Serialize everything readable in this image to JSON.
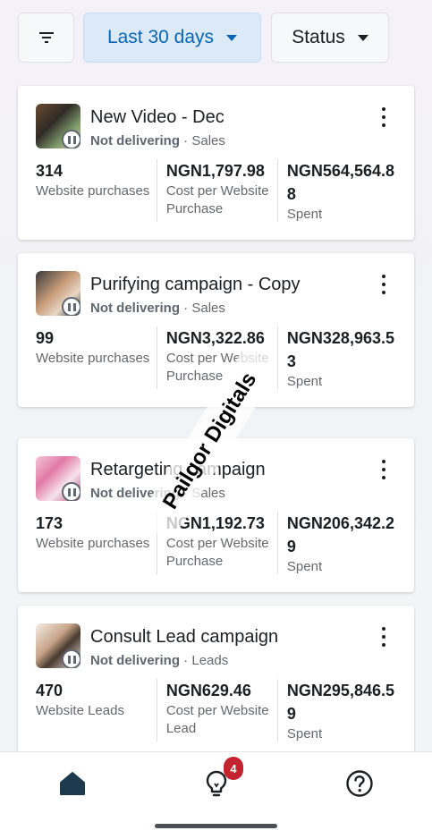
{
  "filters": {
    "filter_icon": "filter-lines-icon",
    "date_range": "Last 30 days",
    "status": "Status"
  },
  "campaigns": [
    {
      "title": "New Video - Dec",
      "state": "Not delivering",
      "objective": "Sales",
      "m1_value": "314",
      "m1_label": "Website purchases",
      "m2_value": "NGN1,797.98",
      "m2_label": "Cost per Website Purchase",
      "m3_value": "NGN564,564.88",
      "m3_label": "Spent"
    },
    {
      "title": "Purifying campaign - Copy",
      "state": "Not delivering",
      "objective": "Sales",
      "m1_value": "99",
      "m1_label": "Website purchases",
      "m2_value": "NGN3,322.86",
      "m2_label": "Cost per Website Purchase",
      "m3_value": "NGN328,963.53",
      "m3_label": "Spent"
    },
    {
      "title": "Retargeting campaign",
      "state": "Not delivering",
      "objective": "Sales",
      "m1_value": "173",
      "m1_label": "Website purchases",
      "m2_value": "NGN1,192.73",
      "m2_label": "Cost per Website Purchase",
      "m3_value": "NGN206,342.29",
      "m3_label": "Spent"
    },
    {
      "title": "Consult Lead campaign",
      "state": "Not delivering",
      "objective": "Leads",
      "m1_value": "470",
      "m1_label": "Website Leads",
      "m2_value": "NGN629.46",
      "m2_label": "Cost per Website Lead",
      "m3_value": "NGN295,846.59",
      "m3_label": "Spent"
    }
  ],
  "watermark": "Pailgor Digitals",
  "bottom_nav": {
    "home_icon": "home-icon",
    "ideas_icon": "lightbulb-icon",
    "ideas_badge": "4",
    "help_icon": "help-circle-icon"
  },
  "colors": {
    "accent": "#0a66b2",
    "accent_bg": "#dceaf7",
    "badge": "#c3242f"
  }
}
